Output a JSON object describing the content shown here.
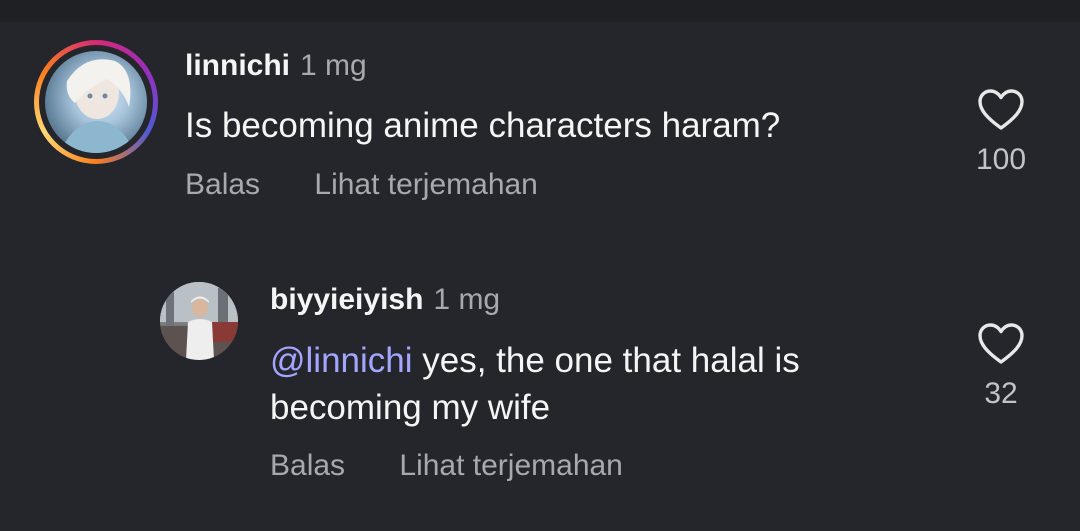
{
  "comments": [
    {
      "username": "linnichi",
      "time": "1 mg",
      "text": "Is becoming anime characters haram?",
      "reply_label": "Balas",
      "translate_label": "Lihat terjemahan",
      "likes": "100",
      "icon": "heart-outline-icon"
    },
    {
      "username": "biyyieiyish",
      "time": "1 mg",
      "mention": "@linnichi",
      "text": " yes, the one that halal is becoming my wife",
      "reply_label": "Balas",
      "translate_label": "Lihat terjemahan",
      "likes": "32",
      "icon": "heart-outline-icon"
    }
  ],
  "colors": {
    "background": "#25262b",
    "mention": "#a3a6ff",
    "secondary_text": "#a8a8ad"
  }
}
